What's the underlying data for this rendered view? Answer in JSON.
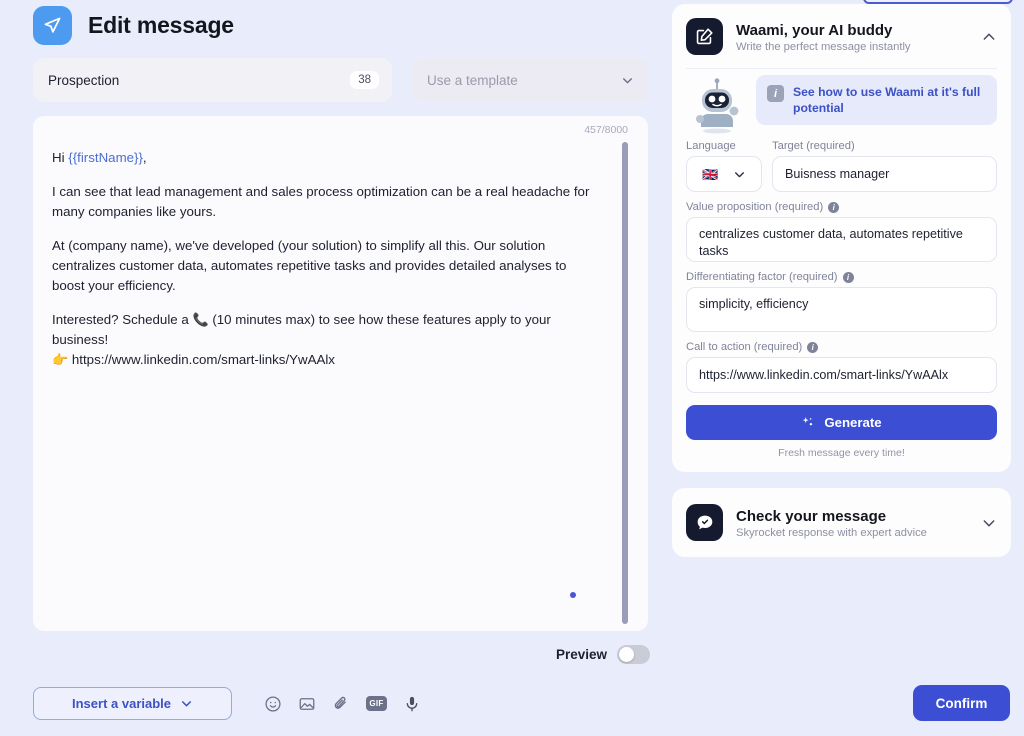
{
  "header": {
    "title": "Edit message",
    "logo_icon": "send-paper-plane-icon",
    "brand_color": "#4d9bf0"
  },
  "fields": {
    "message_name": {
      "value": "Prospection",
      "count_badge": "38"
    },
    "template": {
      "placeholder": "Use a template",
      "chevron_icon": "chevron-down-icon"
    }
  },
  "message": {
    "char_count": "457/8000",
    "lines": {
      "greeting_prefix": "Hi ",
      "greeting_variable": "{{firstName}}",
      "greeting_suffix": ",",
      "para1": "I can see that lead management and sales process optimization can be a real headache for many companies like yours.",
      "para2": "At (company name), we've developed (your solution) to simplify all this. Our solution centralizes customer data, automates repetitive tasks and provides detailed analyses to boost your efficiency.",
      "para3_prefix": "Interested? Schedule a ",
      "para3_emoji": "📞",
      "para3_suffix": " (10 minutes max) to see how these features apply to your business!",
      "para4_emoji": "👉",
      "para4_link": "https://www.linkedin.com/smart-links/YwAAlx"
    },
    "variable_color": "#4a6fd4"
  },
  "preview": {
    "label": "Preview",
    "enabled": false
  },
  "toolbar": {
    "insert_variable_label": "Insert a variable",
    "icons": [
      {
        "name": "emoji-icon"
      },
      {
        "name": "image-icon"
      },
      {
        "name": "attachment-paperclip-icon"
      },
      {
        "name": "gif-icon",
        "label": "GIF"
      },
      {
        "name": "microphone-icon"
      }
    ]
  },
  "confirm": {
    "label": "Confirm",
    "color": "#3c4fd4"
  },
  "waami_card": {
    "icon": "edit-square-icon",
    "title": "Waami, your AI buddy",
    "subtitle": "Write the perfect message instantly",
    "chevron_icon": "chevron-up-icon",
    "mascot_icon": "robot-mascot-icon",
    "banner": {
      "icon": "info-icon",
      "text": "See how to use Waami at it's full potential"
    },
    "form": {
      "language": {
        "label": "Language",
        "flag": "🇬🇧",
        "chevron_icon": "chevron-down-icon"
      },
      "target": {
        "label": "Target (required)",
        "value": "Buisness manager"
      },
      "value_proposition": {
        "label": "Value proposition (required)",
        "info_icon": "info-dot-icon",
        "value": "centralizes customer data, automates repetitive tasks"
      },
      "differentiating_factor": {
        "label": "Differentiating factor (required)",
        "info_icon": "info-dot-icon",
        "value": "simplicity, efficiency"
      },
      "call_to_action": {
        "label": "Call to action (required)",
        "info_icon": "info-dot-icon",
        "value": "https://www.linkedin.com/smart-links/YwAAlx"
      }
    },
    "generate": {
      "label": "Generate",
      "icon": "sparkle-icon",
      "note": "Fresh message every time!"
    }
  },
  "check_card": {
    "icon": "chat-check-icon",
    "title": "Check your message",
    "subtitle": "Skyrocket response with expert advice",
    "chevron_icon": "chevron-down-icon"
  }
}
